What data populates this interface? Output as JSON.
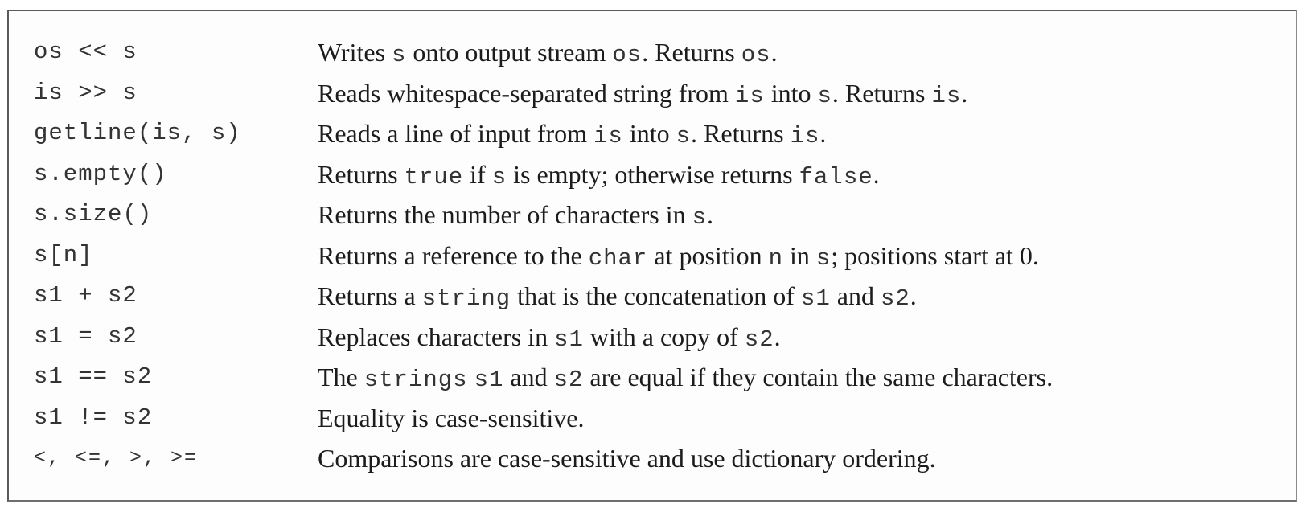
{
  "table": {
    "rows": [
      {
        "op": "os << s",
        "desc": [
          {
            "t": "Writes "
          },
          {
            "c": "s"
          },
          {
            "t": " onto output stream "
          },
          {
            "c": "os"
          },
          {
            "t": ". Returns "
          },
          {
            "c": "os"
          },
          {
            "t": "."
          }
        ]
      },
      {
        "op": "is >> s",
        "desc": [
          {
            "t": "Reads whitespace-separated string from "
          },
          {
            "c": "is"
          },
          {
            "t": " into "
          },
          {
            "c": "s"
          },
          {
            "t": ". Returns "
          },
          {
            "c": "is"
          },
          {
            "t": "."
          }
        ]
      },
      {
        "op": "getline(is, s)",
        "desc": [
          {
            "t": "Reads a line of input from "
          },
          {
            "c": "is"
          },
          {
            "t": " into "
          },
          {
            "c": "s"
          },
          {
            "t": ". Returns "
          },
          {
            "c": "is"
          },
          {
            "t": "."
          }
        ]
      },
      {
        "op": "s.empty()",
        "desc": [
          {
            "t": "Returns "
          },
          {
            "c": "true"
          },
          {
            "t": " if "
          },
          {
            "c": "s"
          },
          {
            "t": " is empty; otherwise returns "
          },
          {
            "c": "false"
          },
          {
            "t": "."
          }
        ]
      },
      {
        "op": "s.size()",
        "desc": [
          {
            "t": "Returns the number of characters in "
          },
          {
            "c": "s"
          },
          {
            "t": "."
          }
        ]
      },
      {
        "op": "s[n]",
        "desc": [
          {
            "t": "Returns a reference to the "
          },
          {
            "c": "char"
          },
          {
            "t": " at position "
          },
          {
            "c": "n"
          },
          {
            "t": " in "
          },
          {
            "c": "s"
          },
          {
            "t": "; positions start at 0."
          }
        ]
      },
      {
        "op": "s1 + s2",
        "desc": [
          {
            "t": "Returns a "
          },
          {
            "c": "string"
          },
          {
            "t": " that is the concatenation of "
          },
          {
            "c": "s1"
          },
          {
            "t": " and "
          },
          {
            "c": "s2"
          },
          {
            "t": "."
          }
        ]
      },
      {
        "op": "s1 = s2",
        "desc": [
          {
            "t": "Replaces characters in "
          },
          {
            "c": "s1"
          },
          {
            "t": " with a copy of "
          },
          {
            "c": "s2"
          },
          {
            "t": "."
          }
        ]
      },
      {
        "op": "s1 == s2",
        "desc": [
          {
            "t": "The "
          },
          {
            "c": "strings"
          },
          {
            "t": " "
          },
          {
            "c": "s1"
          },
          {
            "t": " and "
          },
          {
            "c": "s2"
          },
          {
            "t": " are equal if they contain the same characters."
          }
        ]
      },
      {
        "op": "s1 != s2",
        "desc": [
          {
            "t": "Equality is case-sensitive."
          }
        ]
      },
      {
        "op": "<, <=, >, >=",
        "small": true,
        "desc": [
          {
            "t": "Comparisons are case-sensitive and use dictionary ordering."
          }
        ]
      }
    ]
  }
}
